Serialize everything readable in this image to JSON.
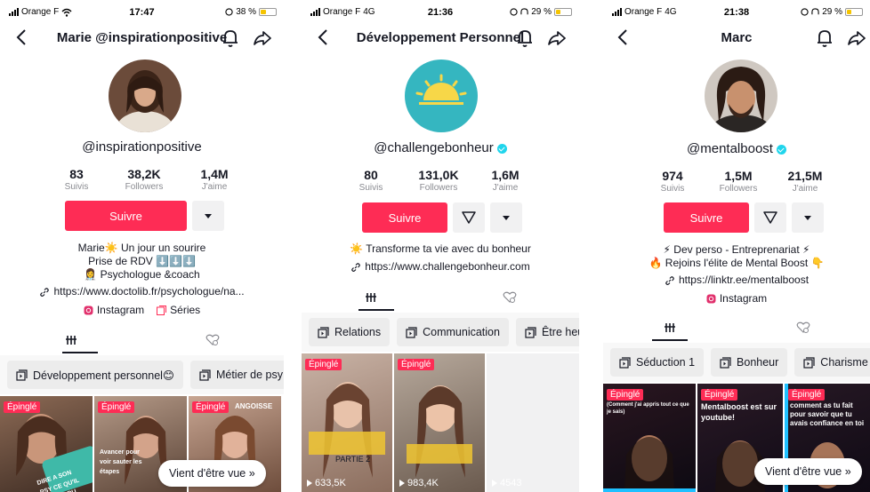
{
  "screens": [
    {
      "status": {
        "carrier": "Orange F",
        "network": "",
        "time": "17:47",
        "battery": "38 %",
        "battery_level": 0.38
      },
      "title": "Marie @inspirationpositive",
      "handle": "@inspirationpositive",
      "verified": false,
      "stats": [
        {
          "num": "83",
          "label": "Suivis"
        },
        {
          "num": "38,2K",
          "label": "Followers"
        },
        {
          "num": "1,4M",
          "label": "J'aime"
        }
      ],
      "follow_label": "Suivre",
      "bio": [
        "Marie☀️ Un jour un sourire",
        "Prise de RDV ⬇️⬇️⬇️",
        "👩‍⚕️ Psychologue &coach"
      ],
      "link": "https://www.doctolib.fr/psychologue/na...",
      "socials": [
        "Instagram",
        "Séries"
      ],
      "playlists": [
        "Développement personnel😊",
        "Métier de psy"
      ],
      "videos": [
        {
          "pinned": "Épinglé",
          "caption": "DIRE A SON PSY CE QU'IL NE FAIT DU",
          "views": ""
        },
        {
          "pinned": "Épinglé",
          "caption": "Avancer pour voir sauter les étapes",
          "views": ""
        },
        {
          "pinned": "Épinglé",
          "caption": "ANGOISSE",
          "views": ""
        }
      ],
      "recent_label": "Vient d'être vue »"
    },
    {
      "status": {
        "carrier": "Orange F",
        "network": "4G",
        "time": "21:36",
        "battery": "29 %",
        "battery_level": 0.29
      },
      "title": "Développement Personnel",
      "handle": "@challengebonheur",
      "verified": true,
      "stats": [
        {
          "num": "80",
          "label": "Suivis"
        },
        {
          "num": "131,0K",
          "label": "Followers"
        },
        {
          "num": "1,6M",
          "label": "J'aime"
        }
      ],
      "follow_label": "Suivre",
      "bio": [
        "☀️ Transforme ta vie avec du bonheur"
      ],
      "link": "https://www.challengebonheur.com",
      "socials": [],
      "playlists": [
        "Relations",
        "Communication",
        "Être heureux"
      ],
      "videos": [
        {
          "pinned": "Épinglé",
          "caption": "PARTIE 2",
          "views": "633,5K"
        },
        {
          "pinned": "Épinglé",
          "caption": "",
          "views": "983,4K"
        },
        {
          "pinned": "",
          "caption": "",
          "views": "4543"
        }
      ],
      "recent_label": ""
    },
    {
      "status": {
        "carrier": "Orange F",
        "network": "4G",
        "time": "21:38",
        "battery": "29 %",
        "battery_level": 0.29
      },
      "title": "Marc",
      "handle": "@mentalboost",
      "verified": true,
      "stats": [
        {
          "num": "974",
          "label": "Suivis"
        },
        {
          "num": "1,5M",
          "label": "Followers"
        },
        {
          "num": "21,5M",
          "label": "J'aime"
        }
      ],
      "follow_label": "Suivre",
      "bio": [
        "⚡ Dev perso - Entreprenariat ⚡",
        "🔥 Rejoins l'élite de Mental Boost 👇"
      ],
      "link": "https://linktr.ee/mentalboost",
      "socials": [
        "Instagram"
      ],
      "playlists": [
        "Séduction 1",
        "Bonheur",
        "Charisme"
      ],
      "videos": [
        {
          "pinned": "Épinglé",
          "caption": "(Comment j'ai appris tout ce que je sais)",
          "views": ""
        },
        {
          "pinned": "Épinglé",
          "caption": "Mentalboost est sur youtube!",
          "views": ""
        },
        {
          "pinned": "Épinglé",
          "caption": "comment as tu fait pour savoir que tu avais confiance en toi",
          "views": ""
        }
      ],
      "recent_label": "Vient d'être vue »"
    }
  ],
  "colors": {
    "accent": "#fe2c55",
    "verified": "#20d5ec",
    "sun_bg": "#35b6c0",
    "sun": "#f7d748"
  }
}
